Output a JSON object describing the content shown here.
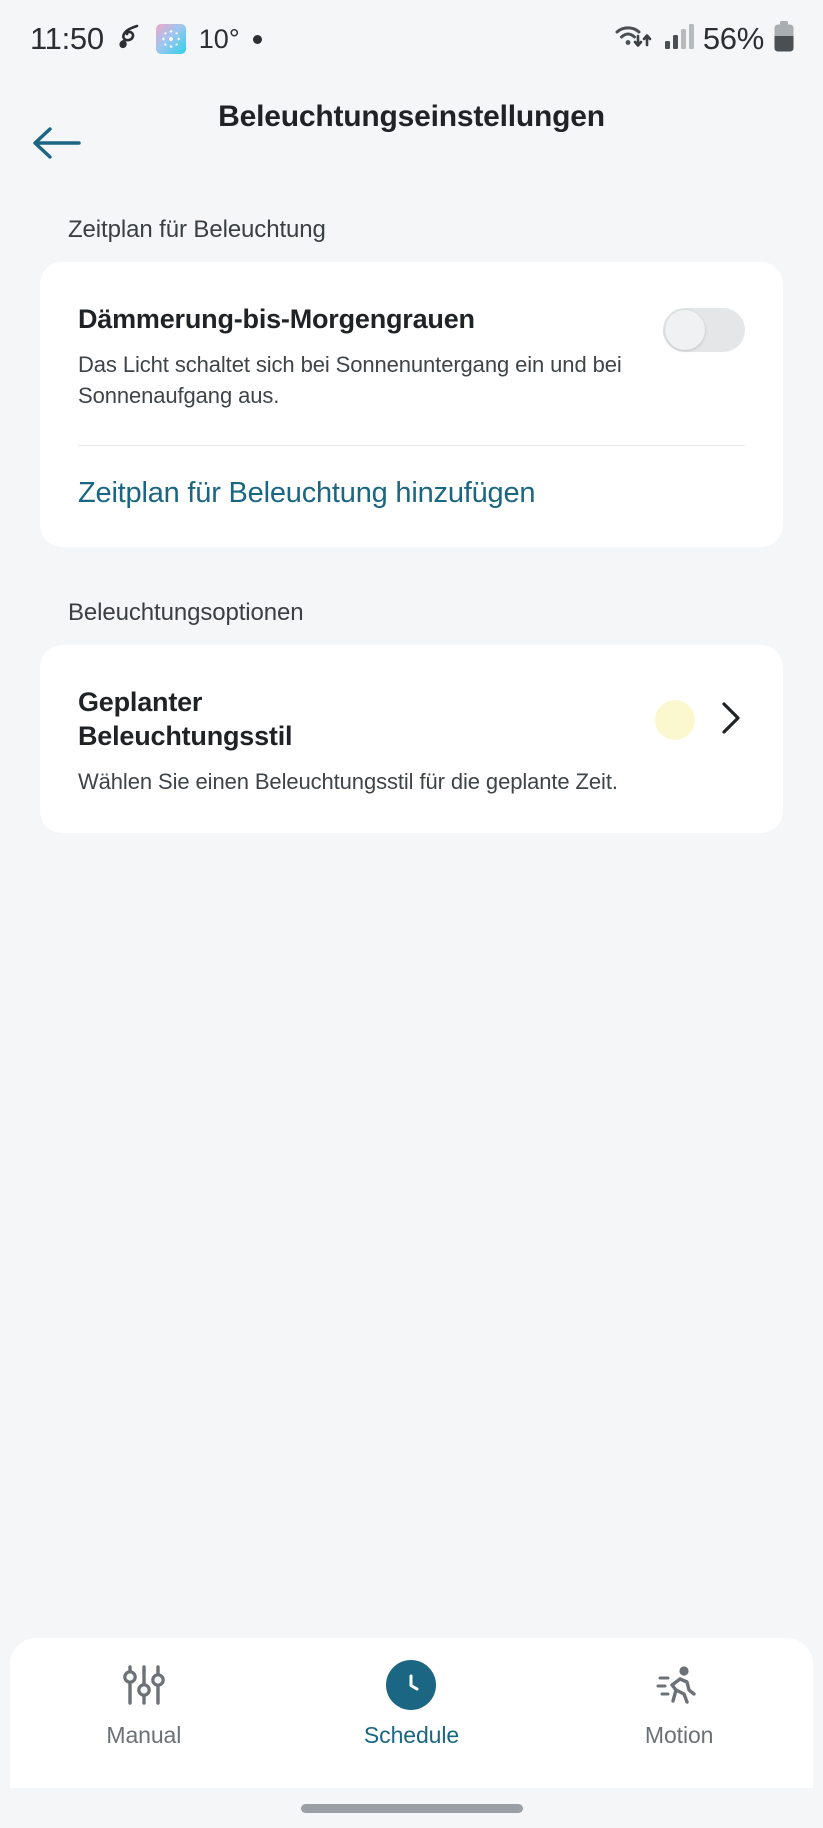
{
  "status_bar": {
    "time": "11:50",
    "temperature": "10°",
    "battery_percent": "56%",
    "icons": {
      "music": "music-note-icon",
      "app_badge": "app-badge-icon",
      "separator_dot": "dot-indicator-icon",
      "wifi": "wifi-data-transfer-icon",
      "signal": "cellular-signal-icon",
      "battery": "battery-icon"
    }
  },
  "header": {
    "title": "Beleuchtungseinstellungen",
    "back_icon": "back-arrow-icon"
  },
  "sections": [
    {
      "label": "Zeitplan für Beleuchtung",
      "card": {
        "title": "Dämmerung-bis-Morgengrauen",
        "description": "Das Licht schaltet sich bei Sonnenuntergang ein und bei Sonnenaufgang aus.",
        "toggle_state": "off",
        "link_label": "Zeitplan für Beleuchtung hinzufügen"
      }
    },
    {
      "label": "Beleuchtungsoptionen",
      "card": {
        "title": "Geplanter Beleuchtungsstil",
        "description": "Wählen Sie einen Beleuchtungsstil für die geplante Zeit.",
        "swatch_color": "#fbf8d0",
        "chevron_icon": "chevron-right-icon"
      }
    }
  ],
  "bottom_nav": {
    "items": [
      {
        "label": "Manual",
        "icon": "sliders-icon",
        "active": false
      },
      {
        "label": "Schedule",
        "icon": "clock-icon",
        "active": true
      },
      {
        "label": "Motion",
        "icon": "running-person-icon",
        "active": false
      }
    ]
  },
  "colors": {
    "accent": "#1b6682",
    "background": "#f4f6f7",
    "card": "#ffffff",
    "text_primary": "#1f2326",
    "text_secondary": "#3e4448"
  }
}
